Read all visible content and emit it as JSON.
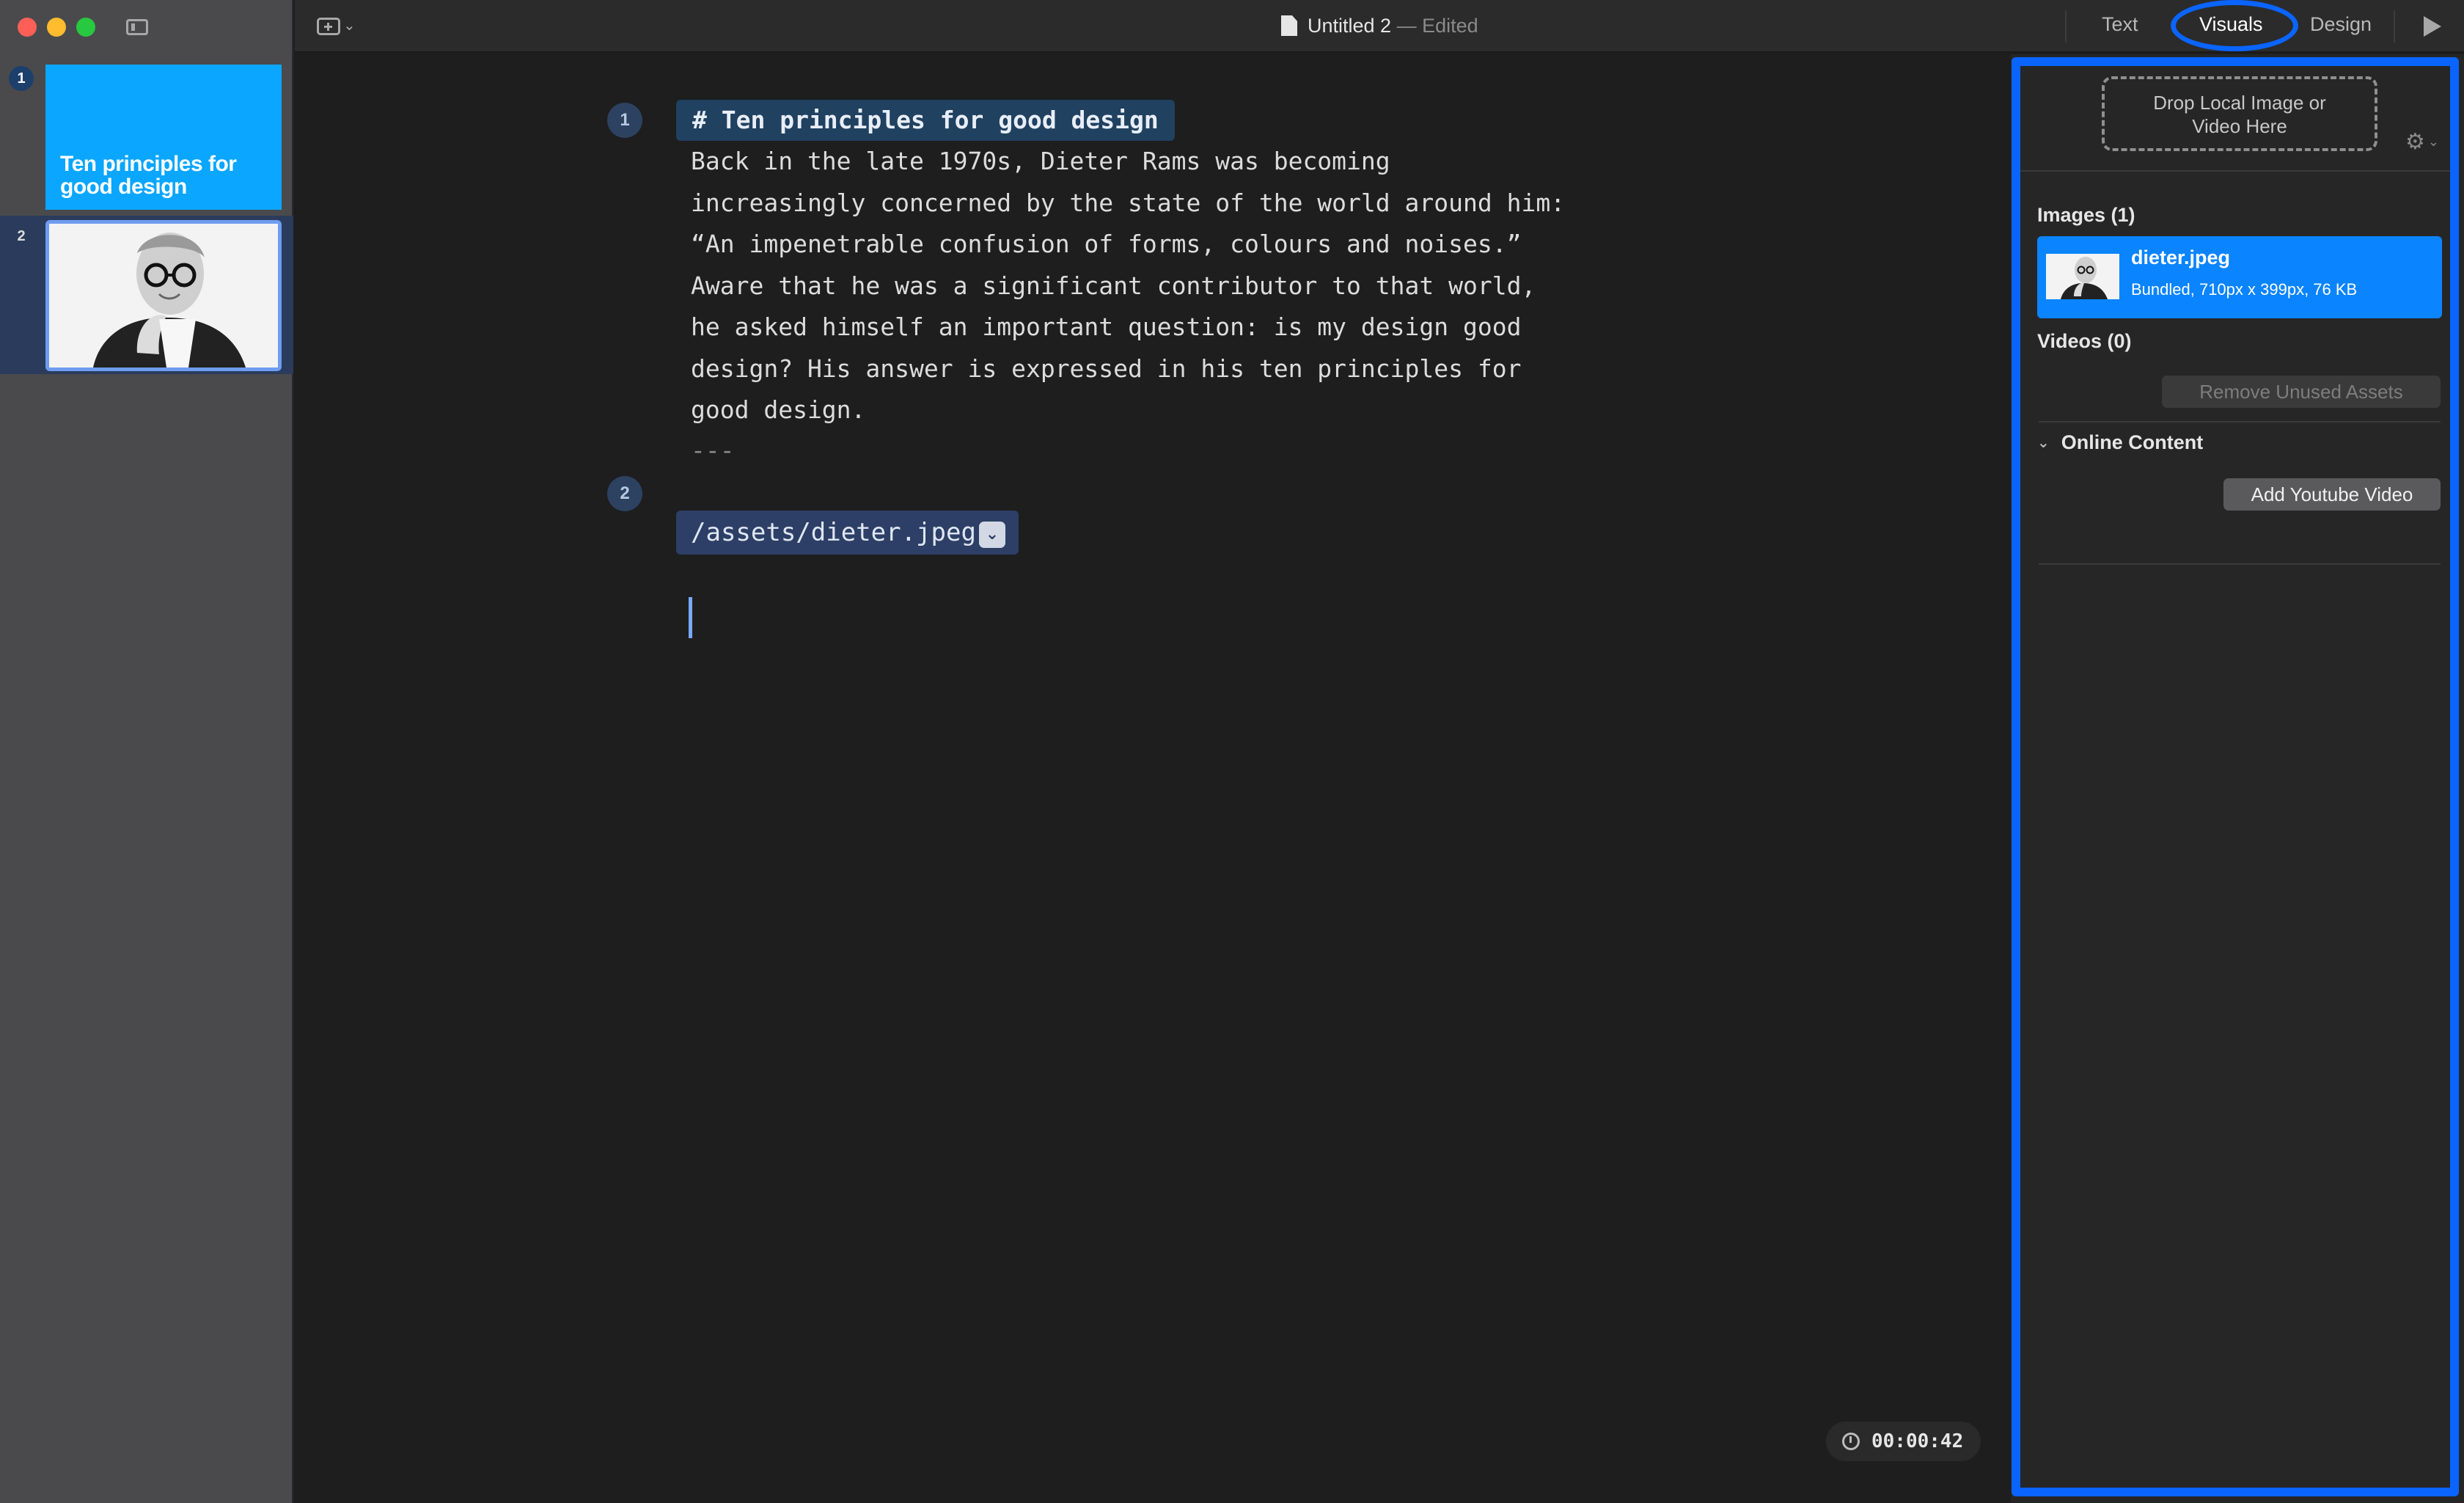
{
  "window": {
    "title": "Untitled 2",
    "status": "Edited"
  },
  "toolbar": {
    "tabs": [
      {
        "label": "Text"
      },
      {
        "label": "Visuals"
      },
      {
        "label": "Design"
      }
    ],
    "active_tab": "Visuals"
  },
  "slides": [
    {
      "number": "1",
      "title": "Ten principles for good design"
    },
    {
      "number": "2",
      "image": "dieter-portrait"
    }
  ],
  "editor": {
    "blocks": [
      {
        "number": "1",
        "heading": "# Ten principles for good design",
        "lines": [
          "Back in the late 1970s, Dieter Rams was becoming",
          "increasingly concerned by the state of the world around him:",
          "“An impenetrable confusion of forms, colours and noises.”",
          "Aware that he was a significant contributor to that world,",
          "he asked himself an important question: is my design good",
          "design? His answer is expressed in his ten principles for",
          "good design."
        ],
        "separator": "---"
      },
      {
        "number": "2",
        "asset_path": "/assets/dieter.jpeg",
        "asset_dropdown_icon": "chevron-down-icon"
      }
    ],
    "timer": "00:00:42"
  },
  "visuals_panel": {
    "dropzone_line1": "Drop Local Image or",
    "dropzone_line2": "Video Here",
    "images_header": "Images (1)",
    "images": [
      {
        "name": "dieter.jpeg",
        "meta": "Bundled, 710px x 399px,  76 KB"
      }
    ],
    "videos_header": "Videos (0)",
    "remove_unused_label": "Remove Unused Assets",
    "online_content_label": "Online Content",
    "add_youtube_label": "Add Youtube Video"
  },
  "colors": {
    "accent": "#0a64ff",
    "selection": "#0a84ff",
    "slide1_bg": "#0aa6ff",
    "traffic_red": "#ff5f57",
    "traffic_yellow": "#febc2e",
    "traffic_green": "#28c840"
  }
}
